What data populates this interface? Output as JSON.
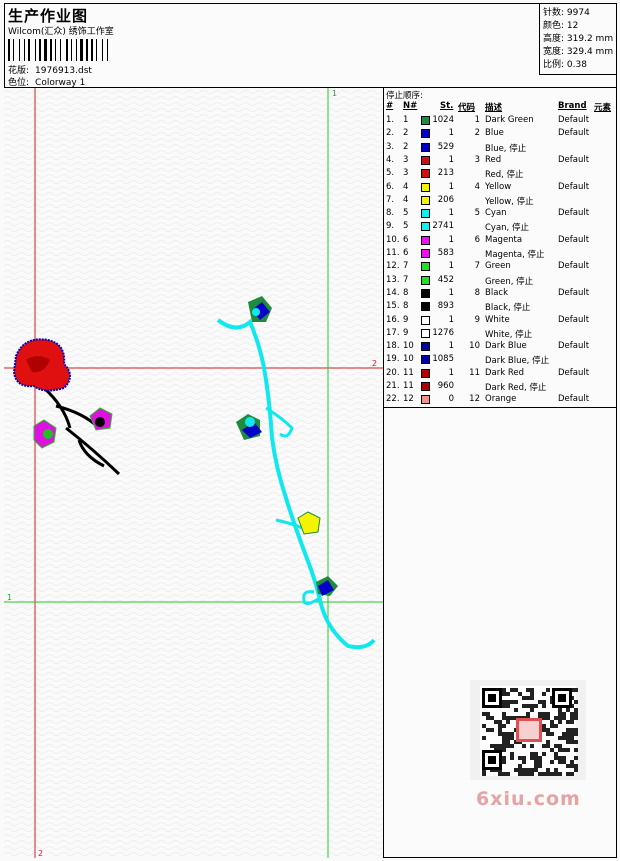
{
  "header": {
    "title": "生产作业图",
    "company": "Wilcom(汇众) 绣饰工作室",
    "design_label": "花版:",
    "design_value": "1976913.dst",
    "colorway_label": "色位:",
    "colorway_value": "Colorway 1"
  },
  "stats": {
    "stitches_label": "针数:",
    "stitches_value": "9974",
    "colors_label": "颜色:",
    "colors_value": "12",
    "height_label": "高度:",
    "height_value": "319.2 mm",
    "width_label": "宽度:",
    "width_value": "329.4 mm",
    "scale_label": "比例:",
    "scale_value": "0.38"
  },
  "guides": {
    "v1": "1",
    "v2": "2",
    "h1": "1",
    "h2": "2"
  },
  "table": {
    "caption": "停止顺序:",
    "headers": [
      "#",
      "N#",
      "St.",
      "代码",
      "描述",
      "Brand",
      "元素"
    ],
    "rows": [
      {
        "idx": "1.",
        "n": "1",
        "color": "#1e8c3a",
        "st": "1024",
        "code": "1",
        "desc": "Dark Green",
        "brand": "Default"
      },
      {
        "idx": "2.",
        "n": "2",
        "color": "#0000c8",
        "st": "1",
        "code": "2",
        "desc": "Blue",
        "brand": "Default"
      },
      {
        "idx": "3.",
        "n": "2",
        "color": "#0000c8",
        "st": "529",
        "code": "",
        "desc": "Blue, 停止",
        "brand": ""
      },
      {
        "idx": "4.",
        "n": "3",
        "color": "#d01010",
        "st": "1",
        "code": "3",
        "desc": "Red",
        "brand": "Default"
      },
      {
        "idx": "5.",
        "n": "3",
        "color": "#d01010",
        "st": "213",
        "code": "",
        "desc": "Red, 停止",
        "brand": ""
      },
      {
        "idx": "6.",
        "n": "4",
        "color": "#f4f400",
        "st": "1",
        "code": "4",
        "desc": "Yellow",
        "brand": "Default"
      },
      {
        "idx": "7.",
        "n": "4",
        "color": "#f4f400",
        "st": "206",
        "code": "",
        "desc": "Yellow, 停止",
        "brand": ""
      },
      {
        "idx": "8.",
        "n": "5",
        "color": "#10f0f0",
        "st": "1",
        "code": "5",
        "desc": "Cyan",
        "brand": "Default"
      },
      {
        "idx": "9.",
        "n": "5",
        "color": "#10f0f0",
        "st": "2741",
        "code": "",
        "desc": "Cyan, 停止",
        "brand": ""
      },
      {
        "idx": "10.",
        "n": "6",
        "color": "#f010f0",
        "st": "1",
        "code": "6",
        "desc": "Magenta",
        "brand": "Default"
      },
      {
        "idx": "11.",
        "n": "6",
        "color": "#f010f0",
        "st": "583",
        "code": "",
        "desc": "Magenta, 停止",
        "brand": ""
      },
      {
        "idx": "12.",
        "n": "7",
        "color": "#20e020",
        "st": "1",
        "code": "7",
        "desc": "Green",
        "brand": "Default"
      },
      {
        "idx": "13.",
        "n": "7",
        "color": "#20e020",
        "st": "452",
        "code": "",
        "desc": "Green, 停止",
        "brand": ""
      },
      {
        "idx": "14.",
        "n": "8",
        "color": "#000000",
        "st": "1",
        "code": "8",
        "desc": "Black",
        "brand": "Default"
      },
      {
        "idx": "15.",
        "n": "8",
        "color": "#000000",
        "st": "893",
        "code": "",
        "desc": "Black, 停止",
        "brand": ""
      },
      {
        "idx": "16.",
        "n": "9",
        "color": "#ffffff",
        "st": "1",
        "code": "9",
        "desc": "White",
        "brand": "Default"
      },
      {
        "idx": "17.",
        "n": "9",
        "color": "#ffffff",
        "st": "1276",
        "code": "",
        "desc": "White, 停止",
        "brand": ""
      },
      {
        "idx": "18.",
        "n": "10",
        "color": "#0000a8",
        "st": "1",
        "code": "10",
        "desc": "Dark Blue",
        "brand": "Default"
      },
      {
        "idx": "19.",
        "n": "10",
        "color": "#0000a8",
        "st": "1085",
        "code": "",
        "desc": "Dark Blue, 停止",
        "brand": ""
      },
      {
        "idx": "20.",
        "n": "11",
        "color": "#b00000",
        "st": "1",
        "code": "11",
        "desc": "Dark Red",
        "brand": "Default"
      },
      {
        "idx": "21.",
        "n": "11",
        "color": "#b00000",
        "st": "960",
        "code": "",
        "desc": "Dark Red, 停止",
        "brand": ""
      },
      {
        "idx": "22.",
        "n": "12",
        "color": "#f09090",
        "st": "0",
        "code": "12",
        "desc": "Orange",
        "brand": "Default"
      }
    ]
  },
  "watermark": "6xiu.com"
}
